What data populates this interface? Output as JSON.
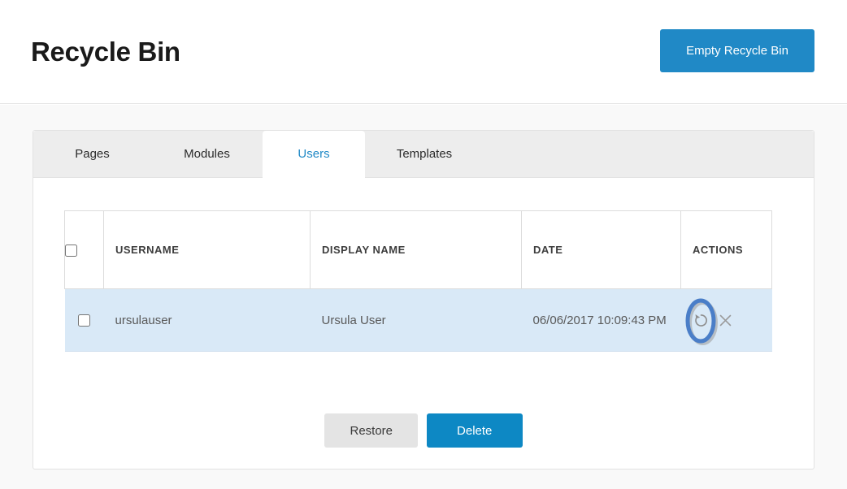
{
  "header": {
    "title": "Recycle Bin",
    "empty_button_label": "Empty Recycle Bin"
  },
  "tabs": [
    {
      "label": "Pages",
      "active": false
    },
    {
      "label": "Modules",
      "active": false
    },
    {
      "label": "Users",
      "active": true
    },
    {
      "label": "Templates",
      "active": false
    }
  ],
  "table": {
    "columns": [
      "USERNAME",
      "DISPLAY NAME",
      "DATE",
      "ACTIONS"
    ],
    "rows": [
      {
        "username": "ursulauser",
        "display_name": "Ursula User",
        "date": "06/06/2017 10:09:43 PM",
        "selected": false,
        "actions": {
          "restore_icon": "restore-circular-arrow-icon",
          "delete_icon": "close-x-icon"
        }
      }
    ]
  },
  "footer": {
    "restore_label": "Restore",
    "delete_label": "Delete"
  },
  "annotation": {
    "target": "restore-action-icon",
    "shape": "ellipse",
    "color": "#4a7ec8"
  },
  "colors": {
    "accent_blue": "#2089c6",
    "delete_blue": "#0d88c4",
    "row_highlight": "#d9e9f7",
    "tabbar_gray": "#ededed",
    "restore_gray": "#e4e4e4",
    "page_bg": "#f9f9f9"
  }
}
